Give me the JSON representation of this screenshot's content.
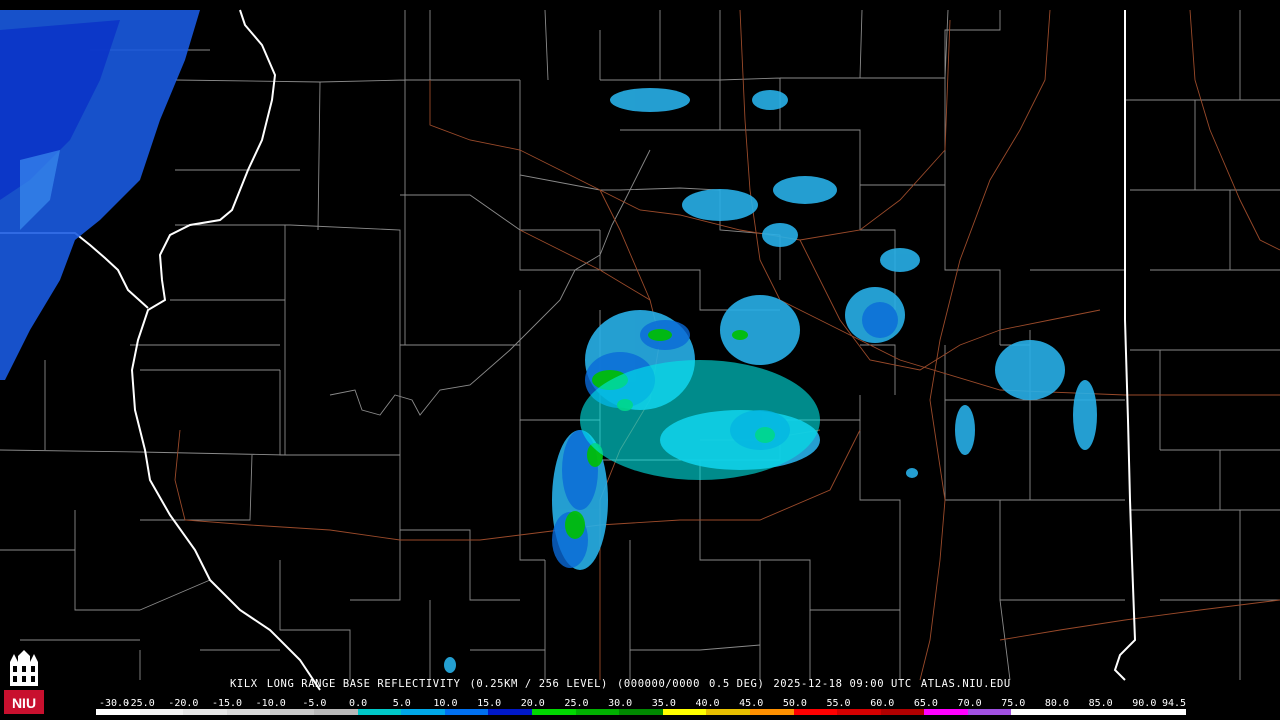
{
  "product": {
    "station": "KILX",
    "name": "LONG RANGE BASE REFLECTIVITY",
    "resolution": "(0.25KM / 256 LEVEL)",
    "volume": "(000000/0000",
    "elevation": "0.5 DEG)",
    "timestamp": "2025-12-18 09:00 UTC",
    "source": "ATLAS.NIU.EDU"
  },
  "logo": {
    "text": "NIU",
    "colors": {
      "bg": "#c8102e",
      "fg": "#ffffff"
    }
  },
  "scale": {
    "ticks": [
      "-30.0",
      "-25.0",
      "-20.0",
      "-15.0",
      "-10.0",
      "-5.0",
      "0.0",
      "5.0",
      "10.0",
      "15.0",
      "20.0",
      "25.0",
      "30.0",
      "35.0",
      "40.0",
      "45.0",
      "50.0",
      "55.0",
      "60.0",
      "65.0",
      "70.0",
      "75.0",
      "80.0",
      "85.0",
      "90.0",
      "94.5"
    ],
    "colors": [
      "#ffffff",
      "#f2f2f2",
      "#e5e5e5",
      "#d8d8d8",
      "#c8c8c8",
      "#b8b8b8",
      "#00c8c8",
      "#00a8e8",
      "#0070f0",
      "#0018c8",
      "#00d800",
      "#00b000",
      "#008800",
      "#ffff00",
      "#e8c000",
      "#ff9000",
      "#ff0000",
      "#d40000",
      "#b00000",
      "#ff00ff",
      "#a050e0",
      "#ffffff",
      "#ffffff",
      "#ffffff",
      "#ffffff"
    ]
  },
  "colors": {
    "background": "#000000",
    "county_lines": "#8a8a8a",
    "state_lines": "#ffffff",
    "highways": "#9a4a2a"
  }
}
